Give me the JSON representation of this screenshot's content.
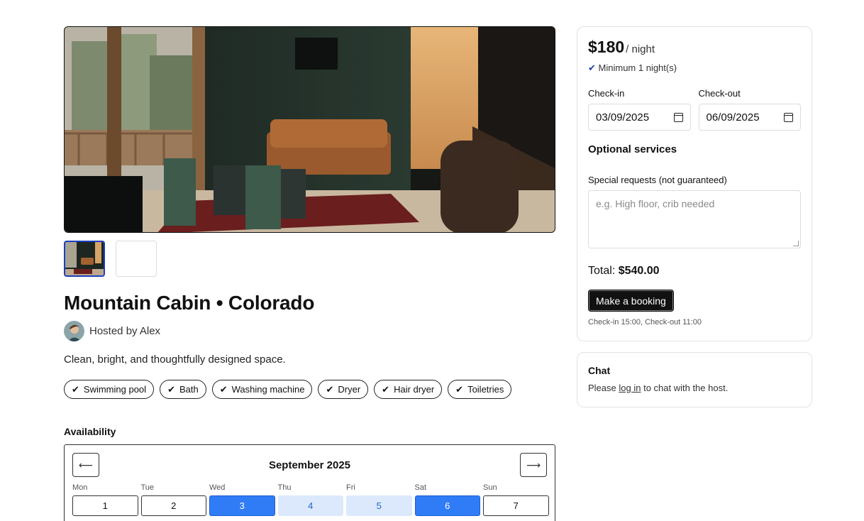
{
  "listing": {
    "title": "Mountain Cabin • Colorado",
    "host": "Hosted by Alex",
    "description": "Clean, bright, and thoughtfully designed space."
  },
  "amenities": [
    "Swimming pool",
    "Bath",
    "Washing machine",
    "Dryer",
    "Hair dryer",
    "Toiletries"
  ],
  "availability": {
    "title": "Availability",
    "month": "September 2025",
    "prev_label": "⟵",
    "next_label": "⟶",
    "weekdays": [
      "Mon",
      "Tue",
      "Wed",
      "Thu",
      "Fri",
      "Sat",
      "Sun"
    ],
    "days": [
      "1",
      "2",
      "3",
      "4",
      "5",
      "6",
      "7"
    ]
  },
  "booking": {
    "price": "$180",
    "per": "/ night",
    "min_check": "✔",
    "min_nights": "Minimum 1 night(s)",
    "checkin_label": "Check-in",
    "checkin_value": "03/09/2025",
    "checkout_label": "Check-out",
    "checkout_value": "06/09/2025",
    "optional_services": "Optional services",
    "special_label": "Special requests (not guaranteed)",
    "special_placeholder": "e.g. High floor, crib needed",
    "total_label": "Total:",
    "total_value": "$540.00",
    "button": "Make a booking",
    "note": "Check-in 15:00, Check-out 11:00"
  },
  "chat": {
    "title": "Chat",
    "text_before": "Please",
    "link": "log in",
    "text_after": "to chat with the host."
  },
  "colors": {
    "accent": "#2f7cf6",
    "range": "#dce9fd",
    "button": "#111111"
  }
}
